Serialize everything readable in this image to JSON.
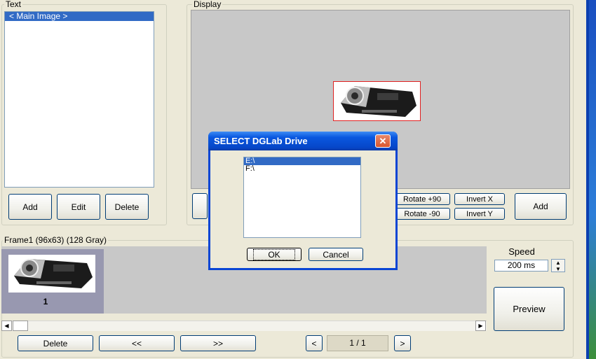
{
  "text_panel": {
    "label": "Text",
    "items": [
      "< Main Image >"
    ],
    "add_label": "Add",
    "edit_label": "Edit",
    "delete_label": "Delete"
  },
  "display_panel": {
    "label": "Display",
    "rotate_plus_label": "Rotate +90",
    "rotate_minus_label": "Rotate -90",
    "invert_x_label": "Invert X",
    "invert_y_label": "Invert Y",
    "add_label": "Add"
  },
  "frame_panel": {
    "label": "Frame1 (96x63)  (128 Gray)",
    "thumb_number": "1",
    "delete_label": "Delete",
    "prev_label": "<<",
    "next_label": ">>",
    "page_prev": "<",
    "page_next": ">",
    "page_indicator": "1 / 1"
  },
  "speed": {
    "label": "Speed",
    "value": "200 ms",
    "preview_label": "Preview"
  },
  "dialog": {
    "title": "SELECT DGLab Drive",
    "drives": [
      "E:\\",
      "F:\\"
    ],
    "ok_label": "OK",
    "cancel_label": "Cancel"
  }
}
